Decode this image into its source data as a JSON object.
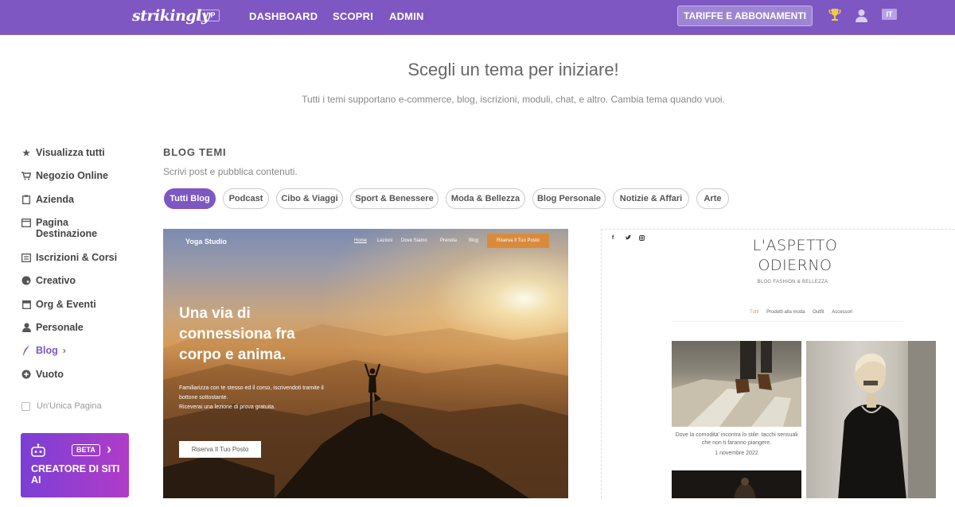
{
  "topbar": {
    "logo": "strikingly",
    "vip": "VIP",
    "nav": [
      "DASHBOARD",
      "SCOPRI",
      "ADMIN"
    ],
    "pricing": "TARIFFE E ABBONAMENTI",
    "lang": "IT",
    "icons": [
      "trophy-icon",
      "user-icon"
    ]
  },
  "header": {
    "title": "Scegli un tema per iniziare!",
    "subtitle": "Tutti i temi supportano e-commerce, blog, iscrizioni, moduli, chat, e altro. Cambia tema quando vuoi."
  },
  "sidebar": {
    "items": [
      {
        "label": "Visualizza tutti",
        "icon": "star-icon"
      },
      {
        "label": "Negozio Online",
        "icon": "cart-icon"
      },
      {
        "label": "Azienda",
        "icon": "clipboard-icon"
      },
      {
        "label": "Pagina Destinazione",
        "icon": "window-icon"
      },
      {
        "label": "Iscrizioni & Corsi",
        "icon": "list-icon"
      },
      {
        "label": "Creativo",
        "icon": "palette-icon"
      },
      {
        "label": "Org & Eventi",
        "icon": "calendar-icon"
      },
      {
        "label": "Personale",
        "icon": "person-icon"
      },
      {
        "label": "Blog",
        "icon": "quill-icon"
      },
      {
        "label": "Vuoto",
        "icon": "plus-circle-icon"
      }
    ],
    "active": "Blog",
    "one_page": "Un'Unica Pagina",
    "ai": {
      "badge": "BETA",
      "title": "CREATORE DI SITI AI"
    }
  },
  "main": {
    "title": "BLOG TEMI",
    "subtitle": "Scrivi post e pubblica contenuti.",
    "filters": [
      "Tutti Blog",
      "Podcast",
      "Cibo & Viaggi",
      "Sport & Benessere",
      "Moda & Bellezza",
      "Blog Personale",
      "Notizie & Affari",
      "Arte"
    ],
    "active_filter": "Tutti Blog"
  },
  "yoga_card": {
    "brand": "Yoga Studio",
    "nav": [
      "Home",
      "Lezioni",
      "Dove Siamo",
      "Prenota",
      "Blog"
    ],
    "cta": "Riserva Il Tuo Posto",
    "hero": "Una via di connessiona fra corpo e anima.",
    "body1": "Familiarizza con te stesso ed il corso, iscrivendoti tramite il bottone sottostante.",
    "body2": "Riceverai una lezione di prova gratuita.",
    "button": "Riserva Il Tuo Posto"
  },
  "fashion_card": {
    "social": [
      "f",
      "t",
      "o"
    ],
    "title_line1": "L'ASPETTO",
    "title_line2": "ODIERNO",
    "subtitle": "BLOG FASHION & BELLEZZA",
    "tabs": [
      "Tutti",
      "Prodotti alla moda",
      "Outfit",
      "Accessori"
    ],
    "caption": "Dove la comodita' incontra lo stile: tacchi sensuali che non ti faranno piangere.",
    "date": "1 novembre 2022"
  },
  "colors": {
    "brand": "#7e57c2",
    "ai_gradient_start": "#7b3fd6",
    "ai_gradient_end": "#b13cc9",
    "cta": "#d98b3c"
  }
}
